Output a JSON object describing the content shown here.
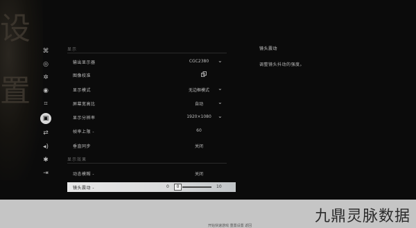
{
  "background": {
    "calligraphy": [
      "设",
      "置"
    ]
  },
  "sidebar": {
    "items": [
      {
        "icon": "gamepad-icon",
        "glyph": "⌘"
      },
      {
        "icon": "controller-icon",
        "glyph": "◎"
      },
      {
        "icon": "gear-icon",
        "glyph": "✲"
      },
      {
        "icon": "eye-icon",
        "glyph": "◉"
      },
      {
        "icon": "crop-icon",
        "glyph": "⌗"
      },
      {
        "icon": "monitor-icon",
        "glyph": "▣"
      },
      {
        "icon": "swap-icon",
        "glyph": "⇄"
      },
      {
        "icon": "speaker-icon",
        "glyph": "◂)"
      },
      {
        "icon": "accessibility-icon",
        "glyph": "✱"
      },
      {
        "icon": "exit-icon",
        "glyph": "⇥"
      }
    ],
    "active_index": 5
  },
  "settings": {
    "section_display": "显示",
    "rows": [
      {
        "label": "输出显示器",
        "value": "CGC2380",
        "dropdown": true
      },
      {
        "label": "图像校准",
        "value": "",
        "copy_icon": true
      },
      {
        "label": "显示模式",
        "value": "无边框模式",
        "dropdown": true
      },
      {
        "label": "屏幕宽高比",
        "value": "自动",
        "dropdown": true
      },
      {
        "label": "显示分辨率",
        "value": "1920×1080",
        "dropdown": true
      },
      {
        "label": "帧率上限 -",
        "value": "60"
      },
      {
        "label": "垂直同步",
        "value": "关闭"
      }
    ],
    "section_effects": "显示效果",
    "effects_rows": [
      {
        "label": "动态模糊 -",
        "value": "关闭"
      }
    ],
    "selected_row": {
      "label": "镜头震动 -",
      "min": "0",
      "value": "0",
      "max": "10",
      "fraction": 0
    }
  },
  "description": {
    "title": "镜头震动",
    "body": "调整镜头抖动的强度。"
  },
  "footer": {
    "hint": "开始快速游戏  重置设置  返回",
    "watermark": "九鼎灵脉数据"
  }
}
